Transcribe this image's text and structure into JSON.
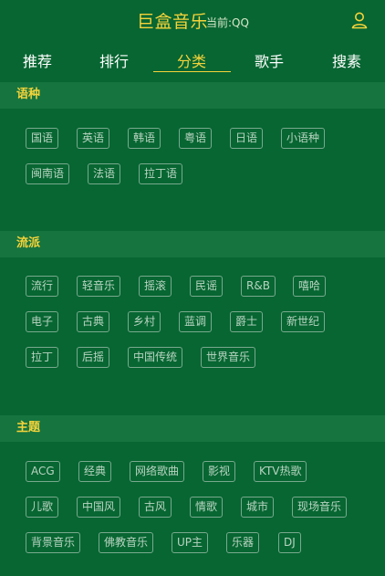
{
  "header": {
    "app_title": "巨盒音乐",
    "source_label": "当前:QQ"
  },
  "nav": {
    "tabs": [
      {
        "label": "推荐"
      },
      {
        "label": "排行"
      },
      {
        "label": "分类",
        "active": true
      },
      {
        "label": "歌手"
      },
      {
        "label": "搜素"
      }
    ]
  },
  "sections": [
    {
      "title": "语种",
      "tags": [
        "国语",
        "英语",
        "韩语",
        "粤语",
        "日语",
        "小语种",
        "闽南语",
        "法语",
        "拉丁语"
      ]
    },
    {
      "title": "流派",
      "tags": [
        "流行",
        "轻音乐",
        "摇滚",
        "民谣",
        "R&B",
        "嘻哈",
        "电子",
        "古典",
        "乡村",
        "蓝调",
        "爵士",
        "新世纪",
        "拉丁",
        "后摇",
        "中国传统",
        "世界音乐"
      ]
    },
    {
      "title": "主题",
      "tags": [
        "ACG",
        "经典",
        "网络歌曲",
        "影视",
        "KTV热歌",
        "儿歌",
        "中国风",
        "古风",
        "情歌",
        "城市",
        "现场音乐",
        "背景音乐",
        "佛教音乐",
        "UP主",
        "乐器",
        "DJ"
      ]
    }
  ],
  "colors": {
    "background": "#076632",
    "section_bar": "#16743f",
    "accent": "#f5d33a",
    "tag_border": "#79a98d",
    "tag_text": "#b9d4c1"
  },
  "icons": {
    "user": "user-icon"
  }
}
